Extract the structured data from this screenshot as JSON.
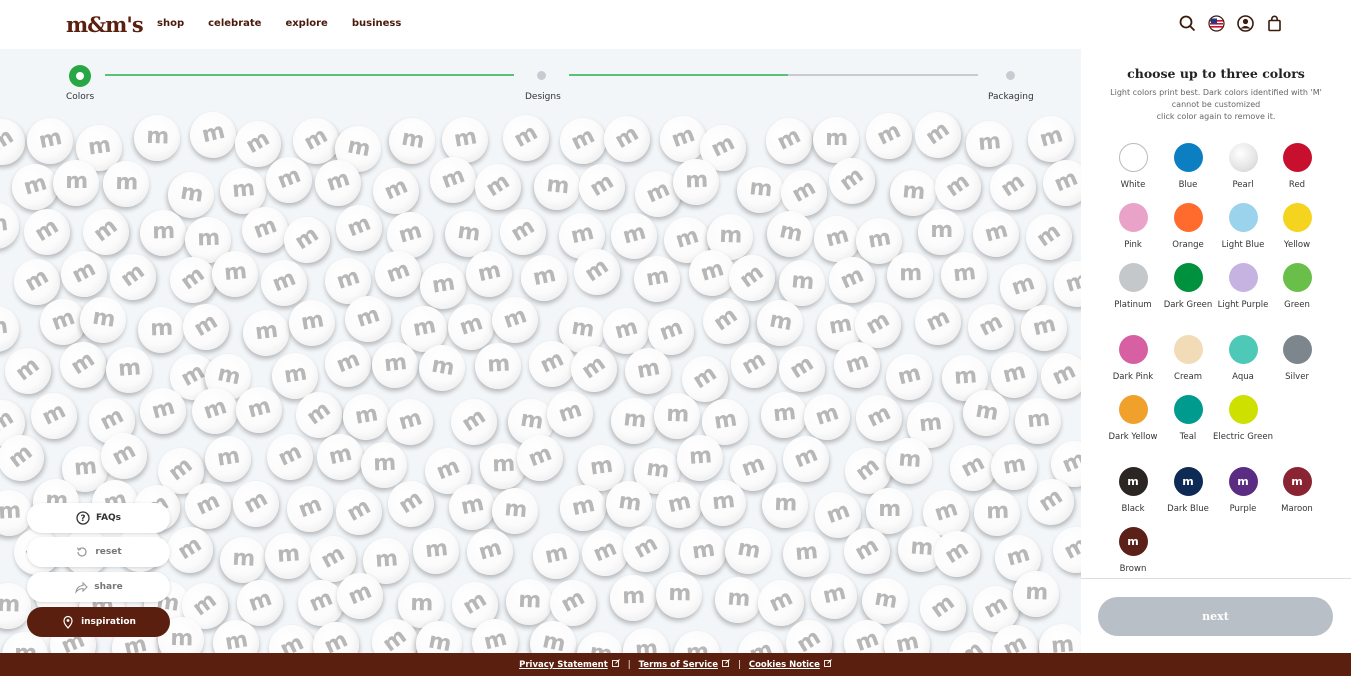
{
  "header": {
    "logo": "m&m's",
    "nav": [
      "shop",
      "celebrate",
      "explore",
      "business"
    ]
  },
  "stepper": {
    "steps": [
      "Colors",
      "Designs",
      "Packaging"
    ]
  },
  "actions": {
    "faqs": "FAQs",
    "reset": "reset",
    "share": "share",
    "inspiration": "inspiration"
  },
  "panel": {
    "title": "choose up to three colors",
    "subtitle_line1": "Light colors print best. Dark colors identified with 'M'",
    "subtitle_line2": "cannot be customized",
    "subtitle_line3": "click color again to remove it.",
    "next_label": "next",
    "colors": [
      {
        "name": "White",
        "hex": "#ffffff",
        "marked": false
      },
      {
        "name": "Blue",
        "hex": "#0b7fc1",
        "marked": false
      },
      {
        "name": "Pearl",
        "hex": "#e9e9e9",
        "marked": false
      },
      {
        "name": "Red",
        "hex": "#c8102e",
        "marked": false
      },
      {
        "name": "Pink",
        "hex": "#e9a3c9",
        "marked": false
      },
      {
        "name": "Orange",
        "hex": "#ff6b2c",
        "marked": false
      },
      {
        "name": "Light Blue",
        "hex": "#9bd3ec",
        "marked": false
      },
      {
        "name": "Yellow",
        "hex": "#f5d41f",
        "marked": false
      },
      {
        "name": "Platinum",
        "hex": "#c5c8cb",
        "marked": false
      },
      {
        "name": "Dark Green",
        "hex": "#00913f",
        "marked": false
      },
      {
        "name": "Light Purple",
        "hex": "#c6b3e1",
        "marked": false
      },
      {
        "name": "Green",
        "hex": "#6abf4b",
        "marked": false
      },
      {
        "name": "Dark Pink",
        "hex": "#d660a2",
        "marked": false
      },
      {
        "name": "Cream",
        "hex": "#f2dcb8",
        "marked": false
      },
      {
        "name": "Aqua",
        "hex": "#4ec9b8",
        "marked": false
      },
      {
        "name": "Silver",
        "hex": "#7d868c",
        "marked": false
      },
      {
        "name": "Dark Yellow",
        "hex": "#f0a12b",
        "marked": false
      },
      {
        "name": "Teal",
        "hex": "#009b8f",
        "marked": false
      },
      {
        "name": "Electric Green",
        "hex": "#cde000",
        "marked": false
      },
      {
        "name": "Black",
        "hex": "#2b2523",
        "marked": true
      },
      {
        "name": "Dark Blue",
        "hex": "#0d2b55",
        "marked": true
      },
      {
        "name": "Purple",
        "hex": "#5a2d82",
        "marked": true
      },
      {
        "name": "Maroon",
        "hex": "#8a2432",
        "marked": true
      },
      {
        "name": "Brown",
        "hex": "#5b2118",
        "marked": true
      }
    ],
    "mark_letter": "m"
  },
  "footer": {
    "privacy": "Privacy Statement",
    "terms": "Terms of Service",
    "cookies": "Cookies Notice",
    "separator": "|"
  },
  "colors": {
    "brand_brown": "#5a1f0e",
    "step_green": "#28a745"
  }
}
